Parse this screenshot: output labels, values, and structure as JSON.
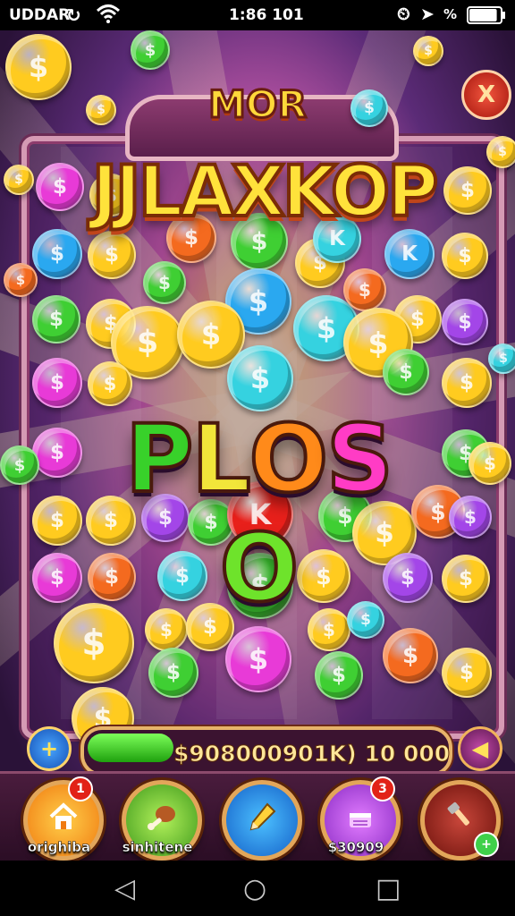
{
  "status_bar": {
    "carrier": "UDDAR",
    "time": "1:86 101",
    "signal": "%",
    "battery_level": 0.9
  },
  "game": {
    "title_top": "MOR",
    "title_main": "JJLAXKOP",
    "big_word_letters": [
      {
        "char": "P",
        "color": "#38d12a"
      },
      {
        "char": "L",
        "color": "#f2e63a"
      },
      {
        "char": "O",
        "color": "#ff8a1a"
      },
      {
        "char": "S",
        "color": "#ff3cc5"
      },
      {
        "char": "O",
        "color": "#6ee32b"
      }
    ],
    "close_label": "X",
    "progress": {
      "value_text": "$908000901K) 10 000",
      "fill_fraction": 0.24
    },
    "left_button_symbol": "+",
    "right_button_symbol": "◀",
    "coin_symbol": "$",
    "coin_symbol_alt": "K",
    "coin_colors": {
      "gold": "#ffcb1f",
      "pink": "#e83ad7",
      "blue": "#2aa8f0",
      "green": "#3fcf33",
      "orange": "#f46a1f",
      "red": "#e8201b",
      "cyan": "#35d2e0",
      "purple": "#a346e8"
    }
  },
  "bottom_nav": [
    {
      "label": "orighiba",
      "icon": "home-icon",
      "badge": "1"
    },
    {
      "label": "sinhitene",
      "icon": "drumstick-icon",
      "badge": ""
    },
    {
      "label": "",
      "icon": "pencil-icon",
      "badge": ""
    },
    {
      "label": "$30909",
      "icon": "cake-icon",
      "badge": "3"
    },
    {
      "label": "",
      "icon": "tool-icon",
      "badge": ""
    }
  ],
  "system_nav": {
    "back": "◁",
    "home": "○",
    "recents": "□"
  }
}
